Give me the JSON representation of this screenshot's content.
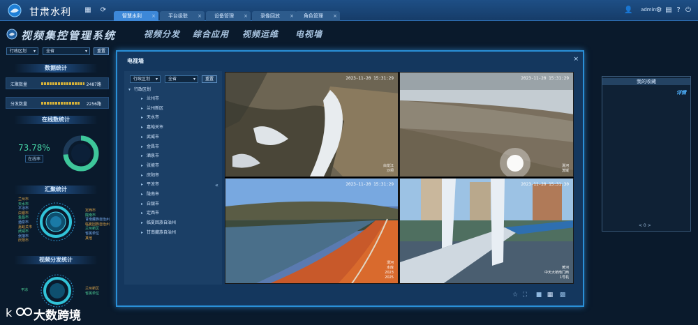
{
  "app": {
    "title": "甘肃水利",
    "system_title": "视频集控管理系统"
  },
  "tabs": [
    {
      "label": "智慧水利"
    },
    {
      "label": "平台级联"
    },
    {
      "label": "设备管理"
    },
    {
      "label": "录像回放"
    },
    {
      "label": "角色管理"
    }
  ],
  "user": {
    "name": "admin"
  },
  "nav": [
    {
      "label": "视频分发"
    },
    {
      "label": "综合应用"
    },
    {
      "label": "视频运维"
    },
    {
      "label": "电视墙"
    }
  ],
  "left": {
    "filter_label": "行政区划",
    "filter_value": "全省",
    "reset_label": "重置",
    "data_stats_title": "数据统计",
    "converge_label": "汇聚数量",
    "converge_value": "2487路",
    "distribute_label": "分发数量",
    "distribute_value": "2256路",
    "online_title": "在线数统计",
    "online_pct": "73.78%",
    "online_label": "在线率",
    "online_pct_value": 73.78,
    "converge_stats_title": "汇聚统计",
    "distribute_stats_title": "视频分发统计",
    "legend_left": [
      "兰州市",
      "天水市",
      "平凉市",
      "白银市",
      "金昌市",
      "酒泉市",
      "嘉峪关市",
      "武威市",
      "张掖市",
      "庆阳市"
    ],
    "legend_right": [
      "定西市",
      "陇南市",
      "甘南藏族自治州",
      "临夏回族自治州",
      "兰州新区",
      "省属单位",
      "其他"
    ],
    "legend2_left": [
      "平凉"
    ],
    "legend2_right": [
      "兰州新区",
      "省属单位"
    ]
  },
  "modal": {
    "title": "电视墙",
    "close": "×",
    "filter_label": "行政区划",
    "filter_value": "全省",
    "reset_label": "重置",
    "tree_root": "行政区划",
    "tree_items": [
      "兰州市",
      "兰州新区",
      "天水市",
      "嘉峪关市",
      "武威市",
      "金昌市",
      "酒泉市",
      "张掖市",
      "庆阳市",
      "平凉市",
      "陇南市",
      "白银市",
      "定西市",
      "临夏回族自治州",
      "甘南藏族自治州"
    ],
    "cameras": [
      {
        "ts": "2023-11-20 15:31:29",
        "loc": "白龙江\n沙坝"
      },
      {
        "ts": "2023-11-20 15:31:29",
        "loc": "洮河\n流域"
      },
      {
        "ts": "2023-11-20 15:31:29",
        "loc": "渭河\n水库\n2023\n2025"
      },
      {
        "ts": "2023-11-20 15:31:30",
        "loc": "黄河\n中天大桥南门西\n1号机"
      }
    ]
  },
  "right": {
    "fav_title": "我的收藏",
    "fav_action": "详情",
    "pager": "< 0 >"
  },
  "watermark": {
    "text": "大数跨境"
  },
  "colors": {
    "accent": "#3d88d8",
    "online": "#45d4a6",
    "bar": "#d4b13a"
  }
}
